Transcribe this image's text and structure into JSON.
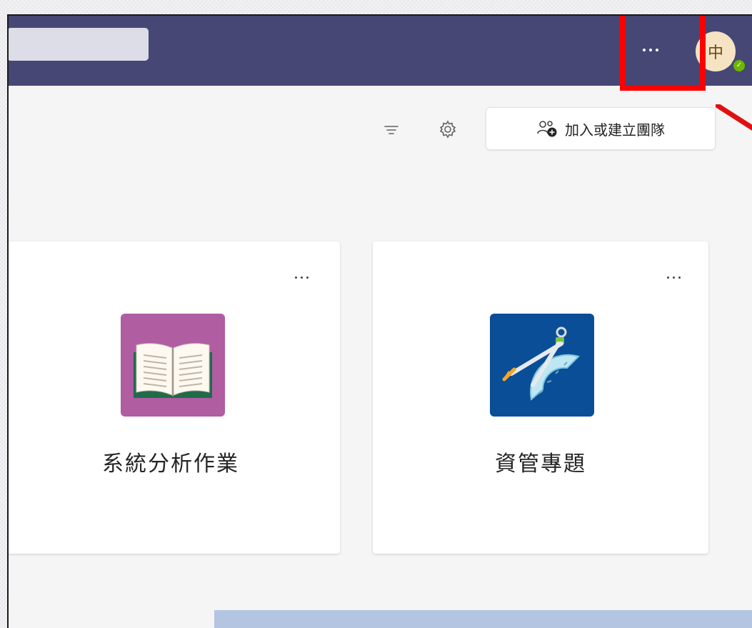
{
  "header": {
    "search_value": "",
    "more_label": "more-options",
    "avatar_initial": "中",
    "presence": "available",
    "bg_color": "#464775"
  },
  "toolbar": {
    "filter_icon": "filter-icon",
    "settings_icon": "gear-icon",
    "join_label": "加入或建立團隊",
    "join_icon": "people-add-icon"
  },
  "teams": [
    {
      "name": "系統分析作業",
      "icon": "open-book-icon",
      "tile_color": "#b05da2"
    },
    {
      "name": "資管專題",
      "icon": "compass-protractor-icon",
      "tile_color": "#0a4e98"
    }
  ],
  "annotation": {
    "color": "#ff0000"
  }
}
